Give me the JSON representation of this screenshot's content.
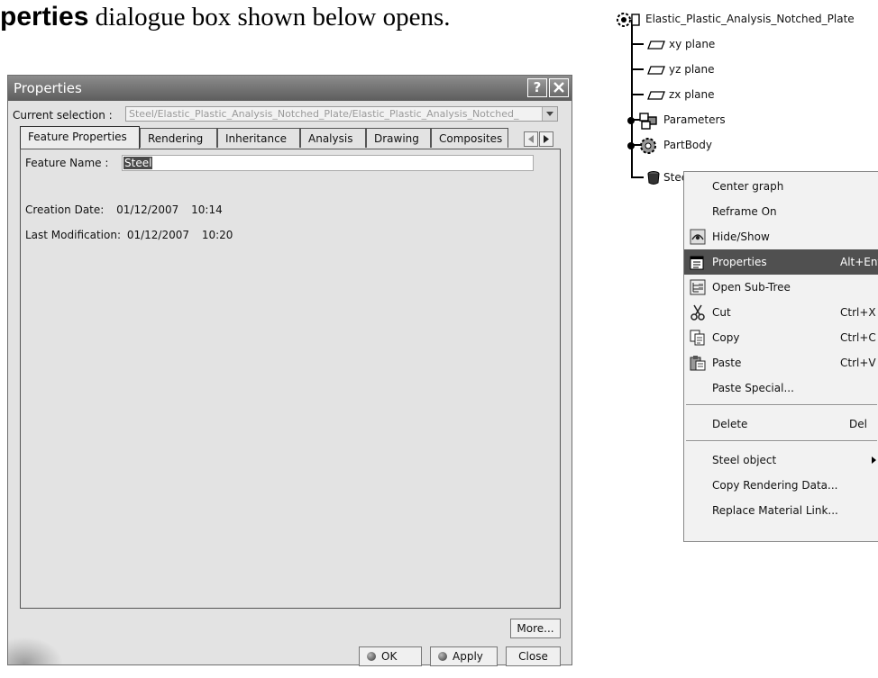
{
  "caption": {
    "bold": "perties",
    "rest": " dialogue box shown below opens."
  },
  "dialog": {
    "title": "Properties",
    "help_button": "?",
    "current_selection_label": "Current selection :",
    "current_selection_value": "Steel/Elastic_Plastic_Analysis_Notched_Plate/Elastic_Plastic_Analysis_Notched_",
    "tabs": [
      {
        "label": "Feature Properties",
        "active": true
      },
      {
        "label": "Rendering"
      },
      {
        "label": "Inheritance"
      },
      {
        "label": "Analysis"
      },
      {
        "label": "Drawing"
      },
      {
        "label": "Composites"
      }
    ],
    "feature_name_label": "Feature Name :",
    "feature_name_value": "Steel",
    "creation_date_label": "Creation Date:",
    "creation_date_value": "01/12/2007",
    "creation_time": "10:14",
    "last_mod_label": "Last Modification:",
    "last_mod_value": "01/12/2007",
    "last_mod_time": "10:20",
    "more_button": "More...",
    "ok_button": "OK",
    "apply_button": "Apply",
    "close_button": "Close"
  },
  "tree": {
    "root": "Elastic_Plastic_Analysis_Notched_Plate",
    "items": [
      {
        "label": "xy plane",
        "icon": "plane-icon"
      },
      {
        "label": "yz plane",
        "icon": "plane-icon"
      },
      {
        "label": "zx plane",
        "icon": "plane-icon"
      },
      {
        "label": "Parameters",
        "icon": "parameters-icon"
      },
      {
        "label": "PartBody",
        "icon": "partbody-icon"
      },
      {
        "label": "Steel",
        "icon": "material-icon"
      }
    ]
  },
  "context_menu": {
    "items": [
      {
        "label": "Center graph",
        "shortcut": ""
      },
      {
        "label": "Reframe On",
        "shortcut": ""
      },
      {
        "label": "Hide/Show",
        "shortcut": "",
        "icon": "hide-show-icon"
      },
      {
        "label": "Properties",
        "shortcut": "Alt+Enter",
        "icon": "properties-icon",
        "highlighted": true
      },
      {
        "label": "Open Sub-Tree",
        "shortcut": "",
        "icon": "subtree-icon"
      },
      {
        "label": "Cut",
        "shortcut": "Ctrl+X",
        "icon": "scissors-icon"
      },
      {
        "label": "Copy",
        "shortcut": "Ctrl+C",
        "icon": "copy-icon"
      },
      {
        "label": "Paste",
        "shortcut": "Ctrl+V",
        "icon": "paste-icon"
      },
      {
        "label": "Paste Special...",
        "shortcut": ""
      },
      {
        "label": "Delete",
        "shortcut": "Del"
      },
      {
        "label": "Steel object",
        "shortcut": "",
        "submenu": true
      },
      {
        "label": "Copy Rendering Data...",
        "shortcut": ""
      },
      {
        "label": "Replace Material Link...",
        "shortcut": ""
      }
    ]
  }
}
